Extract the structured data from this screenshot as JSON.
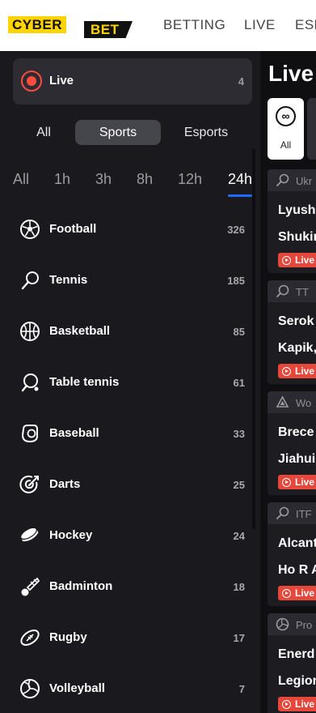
{
  "header": {
    "logo_left": "CYBER",
    "logo_right": "BET",
    "nav": [
      "BETTING",
      "LIVE",
      "ESPORTS"
    ]
  },
  "sidebar": {
    "live": {
      "label": "Live",
      "count": "4"
    },
    "segments": [
      "All",
      "Sports",
      "Esports"
    ],
    "active_segment": "Sports",
    "timeframes": [
      "All",
      "1h",
      "3h",
      "8h",
      "12h",
      "24h"
    ],
    "active_timeframe": "24h",
    "sports": [
      {
        "name": "Football",
        "count": "326",
        "icon": "football-icon"
      },
      {
        "name": "Tennis",
        "count": "185",
        "icon": "tennis-icon"
      },
      {
        "name": "Basketball",
        "count": "85",
        "icon": "basketball-icon"
      },
      {
        "name": "Table tennis",
        "count": "61",
        "icon": "table-tennis-icon"
      },
      {
        "name": "Baseball",
        "count": "33",
        "icon": "baseball-icon"
      },
      {
        "name": "Darts",
        "count": "25",
        "icon": "darts-icon"
      },
      {
        "name": "Hockey",
        "count": "24",
        "icon": "hockey-icon"
      },
      {
        "name": "Badminton",
        "count": "18",
        "icon": "badminton-icon"
      },
      {
        "name": "Rugby",
        "count": "17",
        "icon": "rugby-icon"
      },
      {
        "name": "Volleyball",
        "count": "7",
        "icon": "volleyball-icon"
      }
    ]
  },
  "live_panel": {
    "title": "Live",
    "filter_all_label": "All",
    "matches": [
      {
        "league": "Ukr",
        "player1": "Lyush",
        "player2": "Shukin",
        "badge": "Live",
        "icon": "tennis-icon"
      },
      {
        "league": "TT",
        "player1": "Serok",
        "player2": "Kapik,",
        "badge": "Live",
        "icon": "table-tennis-icon"
      },
      {
        "league": "Wo",
        "player1": "Brece",
        "player2": "Jiahui",
        "badge": "Live",
        "icon": "tournament-icon"
      },
      {
        "league": "ITF",
        "player1": "Alcant",
        "player2": "Ho R A",
        "badge": "Live",
        "icon": "tennis-icon"
      },
      {
        "league": "Pro",
        "player1": "Enerd",
        "player2": "Legion",
        "badge": "Live",
        "icon": "volleyball-icon"
      }
    ]
  },
  "colors": {
    "brand_yellow": "#ffd400",
    "live_red": "#e5473b",
    "accent_blue": "#1f6bff",
    "bg": "#1a1a1e"
  }
}
